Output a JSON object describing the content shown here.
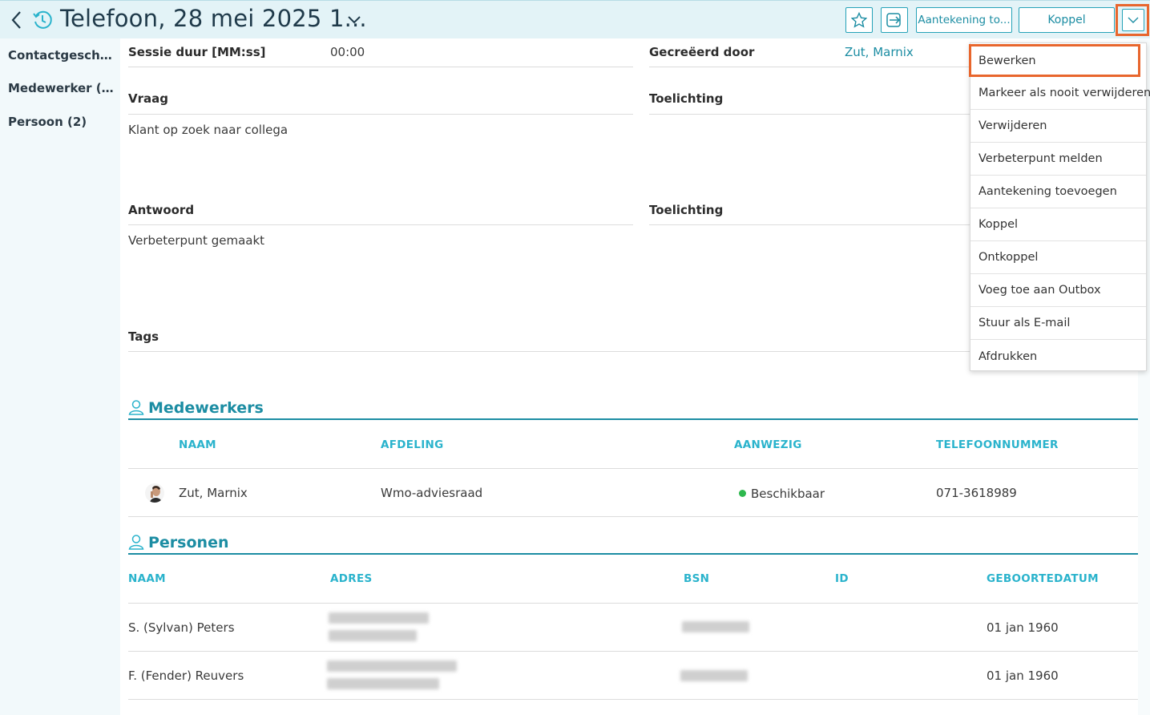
{
  "header": {
    "title": "Telefoon, 28 mei 2025 1...",
    "note_button": "Aantekening to...",
    "koppel_button": "Koppel"
  },
  "sidebar": {
    "items": [
      {
        "label": "Contactgeschie..."
      },
      {
        "label": "Medewerker (1)"
      },
      {
        "label": "Persoon (2)"
      }
    ]
  },
  "form": {
    "session_label": "Sessie duur [MM:ss]",
    "session_value": "00:00",
    "created_by_label": "Gecreëerd door",
    "created_by_value": "Zut, Marnix",
    "question_label": "Vraag",
    "question_value": "Klant op zoek naar collega",
    "question_note_label": "Toelichting",
    "answer_label": "Antwoord",
    "answer_value": "Verbeterpunt gemaakt",
    "answer_note_label": "Toelichting",
    "tags_label": "Tags"
  },
  "employees": {
    "title": "Medewerkers",
    "columns": [
      "NAAM",
      "AFDELING",
      "AANWEZIG",
      "TELEFOONNUMMER"
    ],
    "rows": [
      {
        "name": "Zut, Marnix",
        "department": "Wmo-adviesraad",
        "presence": "Beschikbaar",
        "phone": "071-3618989"
      }
    ]
  },
  "persons": {
    "title": "Personen",
    "columns": [
      "NAAM",
      "ADRES",
      "BSN",
      "ID",
      "GEBOORTEDATUM"
    ],
    "rows": [
      {
        "name": "S. (Sylvan) Peters",
        "birthdate": "01 jan 1960"
      },
      {
        "name": "F. (Fender) Reuvers",
        "birthdate": "01 jan 1960"
      }
    ]
  },
  "menu": {
    "items": [
      "Bewerken",
      "Markeer als nooit verwijderen",
      "Verwijderen",
      "Verbeterpunt melden",
      "Aantekening toevoegen",
      "Koppel",
      "Ontkoppel",
      "Voeg toe aan Outbox",
      "Stuur als E-mail",
      "Afdrukken"
    ]
  },
  "colors": {
    "accent": "#1c8da3",
    "header_bg": "#e3f3f7",
    "highlight": "#e8662d",
    "status_ok": "#2eb84e"
  },
  "icons": [
    "back-icon",
    "history-icon",
    "chevron-down-icon",
    "star-icon",
    "export-icon",
    "person-icon"
  ]
}
